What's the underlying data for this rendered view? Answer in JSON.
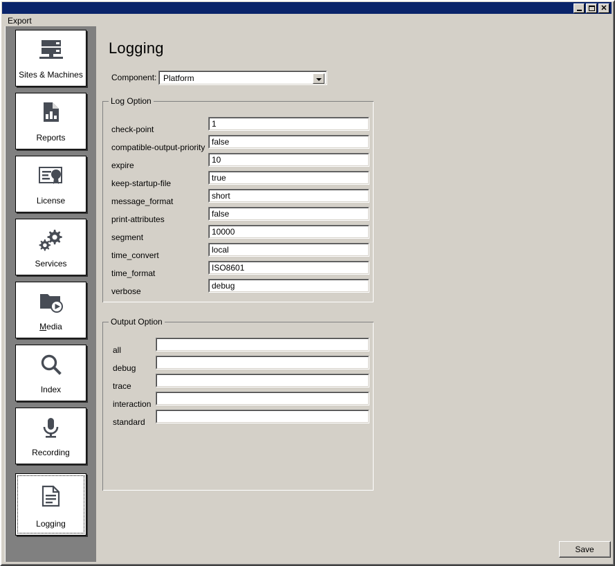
{
  "window": {
    "menu_label": "Export",
    "buttons": {
      "minimize": "–",
      "maximize": "□",
      "close": "×"
    }
  },
  "sidebar": {
    "items": [
      {
        "label": "Sites & Machines",
        "icon": "server-rack-icon",
        "selected": false,
        "accel": ""
      },
      {
        "label": "Reports",
        "icon": "bar-chart-document-icon",
        "selected": false,
        "accel": ""
      },
      {
        "label": "License",
        "icon": "certificate-icon",
        "selected": false,
        "accel": ""
      },
      {
        "label": "Services",
        "icon": "gears-icon",
        "selected": false,
        "accel": ""
      },
      {
        "label": "Media",
        "icon": "folder-play-icon",
        "selected": false,
        "accel": "M"
      },
      {
        "label": "Index",
        "icon": "magnifier-icon",
        "selected": false,
        "accel": ""
      },
      {
        "label": "Recording",
        "icon": "microphone-icon",
        "selected": false,
        "accel": ""
      },
      {
        "label": "Logging",
        "icon": "document-lines-icon",
        "selected": true,
        "accel": ""
      }
    ]
  },
  "main": {
    "title": "Logging",
    "component": {
      "label": "Component:",
      "value": "Platform",
      "options": [
        "Platform"
      ]
    },
    "log_option": {
      "legend": "Log Option",
      "rows": [
        {
          "label": "check-point",
          "value": "1"
        },
        {
          "label": "compatible-output-priority",
          "value": "false"
        },
        {
          "label": "expire",
          "value": "10"
        },
        {
          "label": "keep-startup-file",
          "value": "true"
        },
        {
          "label": "message_format",
          "value": "short"
        },
        {
          "label": "print-attributes",
          "value": "false"
        },
        {
          "label": "segment",
          "value": "10000"
        },
        {
          "label": "time_convert",
          "value": "local"
        },
        {
          "label": "time_format",
          "value": "ISO8601"
        },
        {
          "label": "verbose",
          "value": "debug"
        }
      ]
    },
    "output_option": {
      "legend": "Output Option",
      "rows": [
        {
          "label": "all",
          "value": ""
        },
        {
          "label": "debug",
          "value": ""
        },
        {
          "label": "trace",
          "value": ""
        },
        {
          "label": "interaction",
          "value": ""
        },
        {
          "label": "standard",
          "value": ""
        }
      ]
    },
    "save_label": "Save"
  },
  "colors": {
    "titlebar": "#0a246a",
    "face": "#d4d0c8",
    "sidebar_panel": "#808080",
    "icon": "#474c55",
    "field_bg": "#ffffff"
  }
}
